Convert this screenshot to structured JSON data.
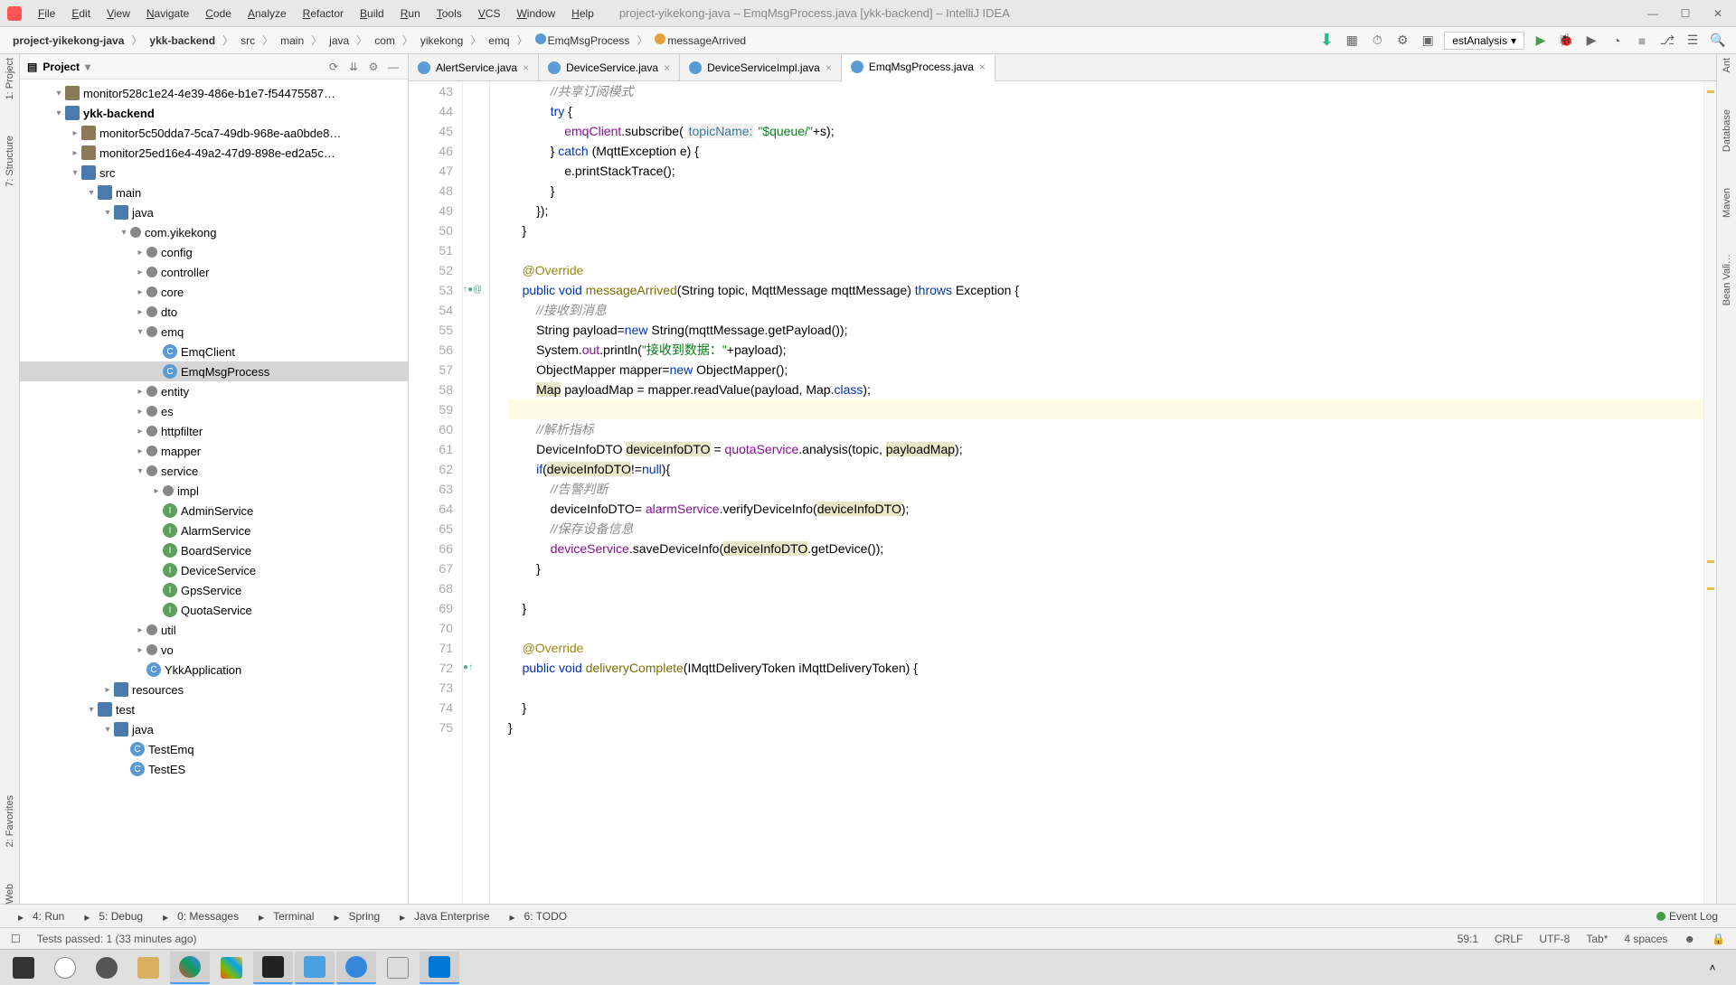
{
  "menu": [
    "File",
    "Edit",
    "View",
    "Navigate",
    "Code",
    "Analyze",
    "Refactor",
    "Build",
    "Run",
    "Tools",
    "VCS",
    "Window",
    "Help"
  ],
  "window_title": "project-yikekong-java – EmqMsgProcess.java [ykk-backend] – IntelliJ IDEA",
  "breadcrumb": [
    "project-yikekong-java",
    "ykk-backend",
    "src",
    "main",
    "java",
    "com",
    "yikekong",
    "emq",
    "EmqMsgProcess",
    "messageArrived"
  ],
  "analysis_dropdown": "estAnalysis",
  "project_panel_title": "Project",
  "tree": [
    {
      "indent": 2,
      "arrow": "▾",
      "icon": "folder",
      "label": "monitor528c1e24-4e39-486e-b1e7-f54475587…"
    },
    {
      "indent": 2,
      "arrow": "▾",
      "icon": "module",
      "label": "ykk-backend",
      "bold": true
    },
    {
      "indent": 3,
      "arrow": "▸",
      "icon": "folder",
      "label": "monitor5c50dda7-5ca7-49db-968e-aa0bde8…"
    },
    {
      "indent": 3,
      "arrow": "▸",
      "icon": "folder",
      "label": "monitor25ed16e4-49a2-47d9-898e-ed2a5c…"
    },
    {
      "indent": 3,
      "arrow": "▾",
      "icon": "module",
      "label": "src"
    },
    {
      "indent": 4,
      "arrow": "▾",
      "icon": "module",
      "label": "main"
    },
    {
      "indent": 5,
      "arrow": "▾",
      "icon": "module",
      "label": "java"
    },
    {
      "indent": 6,
      "arrow": "▾",
      "icon": "package",
      "label": "com.yikekong"
    },
    {
      "indent": 7,
      "arrow": "▸",
      "icon": "package",
      "label": "config"
    },
    {
      "indent": 7,
      "arrow": "▸",
      "icon": "package",
      "label": "controller"
    },
    {
      "indent": 7,
      "arrow": "▸",
      "icon": "package",
      "label": "core"
    },
    {
      "indent": 7,
      "arrow": "▸",
      "icon": "package",
      "label": "dto"
    },
    {
      "indent": 7,
      "arrow": "▾",
      "icon": "package",
      "label": "emq"
    },
    {
      "indent": 8,
      "arrow": "",
      "icon": "class",
      "label": "EmqClient"
    },
    {
      "indent": 8,
      "arrow": "",
      "icon": "class",
      "label": "EmqMsgProcess",
      "selected": true
    },
    {
      "indent": 7,
      "arrow": "▸",
      "icon": "package",
      "label": "entity"
    },
    {
      "indent": 7,
      "arrow": "▸",
      "icon": "package",
      "label": "es"
    },
    {
      "indent": 7,
      "arrow": "▸",
      "icon": "package",
      "label": "httpfilter"
    },
    {
      "indent": 7,
      "arrow": "▸",
      "icon": "package",
      "label": "mapper"
    },
    {
      "indent": 7,
      "arrow": "▾",
      "icon": "package",
      "label": "service"
    },
    {
      "indent": 8,
      "arrow": "▸",
      "icon": "package",
      "label": "impl"
    },
    {
      "indent": 8,
      "arrow": "",
      "icon": "interface",
      "label": "AdminService"
    },
    {
      "indent": 8,
      "arrow": "",
      "icon": "interface",
      "label": "AlarmService"
    },
    {
      "indent": 8,
      "arrow": "",
      "icon": "interface",
      "label": "BoardService"
    },
    {
      "indent": 8,
      "arrow": "",
      "icon": "interface",
      "label": "DeviceService"
    },
    {
      "indent": 8,
      "arrow": "",
      "icon": "interface",
      "label": "GpsService"
    },
    {
      "indent": 8,
      "arrow": "",
      "icon": "interface",
      "label": "QuotaService"
    },
    {
      "indent": 7,
      "arrow": "▸",
      "icon": "package",
      "label": "util"
    },
    {
      "indent": 7,
      "arrow": "▸",
      "icon": "package",
      "label": "vo"
    },
    {
      "indent": 7,
      "arrow": "",
      "icon": "class",
      "label": "YkkApplication"
    },
    {
      "indent": 5,
      "arrow": "▸",
      "icon": "module",
      "label": "resources"
    },
    {
      "indent": 4,
      "arrow": "▾",
      "icon": "module",
      "label": "test"
    },
    {
      "indent": 5,
      "arrow": "▾",
      "icon": "module",
      "label": "java"
    },
    {
      "indent": 6,
      "arrow": "",
      "icon": "class",
      "label": "TestEmq"
    },
    {
      "indent": 6,
      "arrow": "",
      "icon": "class",
      "label": "TestES"
    }
  ],
  "tabs": [
    {
      "label": "AlertService.java"
    },
    {
      "label": "DeviceService.java"
    },
    {
      "label": "DeviceServiceImpl.java"
    },
    {
      "label": "EmqMsgProcess.java",
      "active": true
    }
  ],
  "code_start_line": 43,
  "code_lines": [
    {
      "html": "            <span class='cmt'>//共享订阅模式</span>"
    },
    {
      "html": "            <span class='kw'>try</span> {"
    },
    {
      "html": "                <span class='fld'>emqClient</span>.subscribe( <span class='param'>topicName:</span> <span class='str'>\"$queue/\"</span>+s);"
    },
    {
      "html": "            } <span class='kw'>catch</span> (MqttException e) {"
    },
    {
      "html": "                e.printStackTrace();"
    },
    {
      "html": "            }"
    },
    {
      "html": "        });"
    },
    {
      "html": "    }"
    },
    {
      "html": ""
    },
    {
      "html": "    <span class='ann'>@Override</span>"
    },
    {
      "html": "    <span class='kw'>public</span> <span class='kw'>void</span> <span class='fnd'>messageArrived</span>(String topic, MqttMessage mqttMessage) <span class='kw'>throws</span> Exception {",
      "ann": "↑●@"
    },
    {
      "html": "        <span class='cmt'>//接收到消息</span>"
    },
    {
      "html": "        String payload=<span class='kw'>new</span> String(mqttMessage.getPayload());"
    },
    {
      "html": "        System.<span class='fld'>out</span>.println(<span class='str'>\"接收到数据：\"</span>+payload);"
    },
    {
      "html": "        ObjectMapper mapper=<span class='kw'>new</span> ObjectMapper();"
    },
    {
      "html": "        <span class='hl-ref'>Map</span> payloadMap = mapper.readValue(payload, Map.<span class='kw'>class</span>);"
    },
    {
      "html": "",
      "hl": true
    },
    {
      "html": "        <span class='cmt'>//解析指标</span>"
    },
    {
      "html": "        DeviceInfoDTO <span class='hl-ref'>deviceInfoDTO</span> = <span class='fld'>quotaService</span>.analysis(topic, <span class='hl-ref'>payloadMap</span>);"
    },
    {
      "html": "        <span class='kw'>if</span>(<span class='hl-ref'>deviceInfoDTO</span>!=<span class='kw'>null</span>){"
    },
    {
      "html": "            <span class='cmt'>//告警判断</span>"
    },
    {
      "html": "            deviceInfoDTO= <span class='fld'>alarmService</span>.verifyDeviceInfo(<span class='hl-ref'>deviceInfoDTO</span>);"
    },
    {
      "html": "            <span class='cmt'>//保存设备信息</span>"
    },
    {
      "html": "            <span class='fld'>deviceService</span>.saveDeviceInfo(<span class='hl-ref'>deviceInfoDTO</span>.getDevice());"
    },
    {
      "html": "        }"
    },
    {
      "html": ""
    },
    {
      "html": "    }"
    },
    {
      "html": ""
    },
    {
      "html": "    <span class='ann'>@Override</span>"
    },
    {
      "html": "    <span class='kw'>public</span> <span class='kw'>void</span> <span class='fnd'>deliveryComplete</span>(IMqttDeliveryToken iMqttDeliveryToken) {",
      "ann": "●↑"
    },
    {
      "html": ""
    },
    {
      "html": "    }"
    },
    {
      "html": "}"
    }
  ],
  "bottom_tabs": [
    "4: Run",
    "5: Debug",
    "0: Messages",
    "Terminal",
    "Spring",
    "Java Enterprise",
    "6: TODO"
  ],
  "event_log": "Event Log",
  "status": {
    "msg": "Tests passed: 1 (33 minutes ago)",
    "pos": "59:1",
    "crlf": "CRLF",
    "enc": "UTF-8",
    "tab": "Tab*",
    "spaces": "4 spaces"
  },
  "left_gutter": [
    "1: Project",
    "7: Structure"
  ],
  "left_gutter_bottom": [
    "2: Favorites",
    "Web"
  ],
  "right_gutter": [
    "Ant",
    "Database",
    "Maven",
    "Bean Vali…"
  ]
}
